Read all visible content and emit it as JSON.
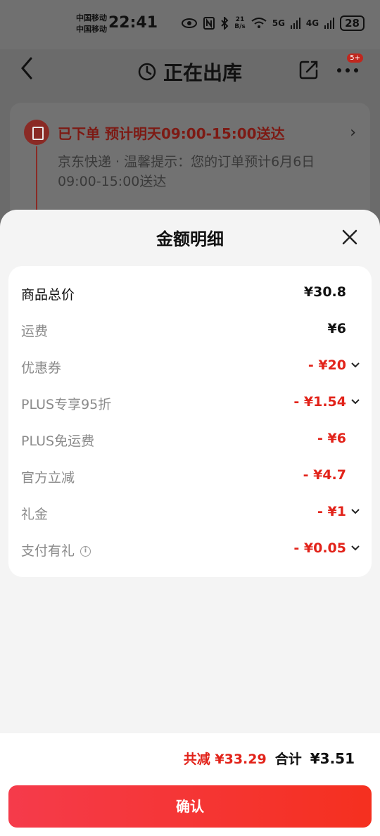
{
  "status_bar": {
    "carrier1": "中国移动",
    "carrier2": "中国移动",
    "time": "22:41",
    "speed_value": "21",
    "speed_unit": "B/s",
    "net1": "5G",
    "net2": "4G",
    "battery": "28"
  },
  "header": {
    "title": "正在出库",
    "badge": "5+",
    "back_icon": "back-arrow-icon",
    "status_icon": "clock-icon",
    "share_icon": "share-icon",
    "more_icon": "more-icon"
  },
  "order": {
    "status": "已下单  预计明天09:00-15:00送达",
    "description": "京东快递 · 温馨提示：您的订单预计6月6日09:00-15:00送达"
  },
  "sheet": {
    "title": "金额明细",
    "rows": [
      {
        "label": "商品总价",
        "value": "¥30.8"
      },
      {
        "label": "运费",
        "value": "¥6"
      },
      {
        "label": "优惠券",
        "value": "- ¥20"
      },
      {
        "label": "PLUS专享95折",
        "value": "- ¥1.54"
      },
      {
        "label": "PLUS免运费",
        "value": "- ¥6"
      },
      {
        "label": "官方立减",
        "value": "- ¥4.7"
      },
      {
        "label": "礼金",
        "value": "- ¥1"
      },
      {
        "label": "支付有礼",
        "value": "- ¥0.05"
      }
    ]
  },
  "footer": {
    "reduced": "共减 ¥33.29",
    "total_label": "合计",
    "total_value": "¥3.51",
    "confirm": "确认"
  },
  "colors": {
    "accent": "#e2231a",
    "button_start": "#f53b4b",
    "button_end": "#f5301f"
  }
}
